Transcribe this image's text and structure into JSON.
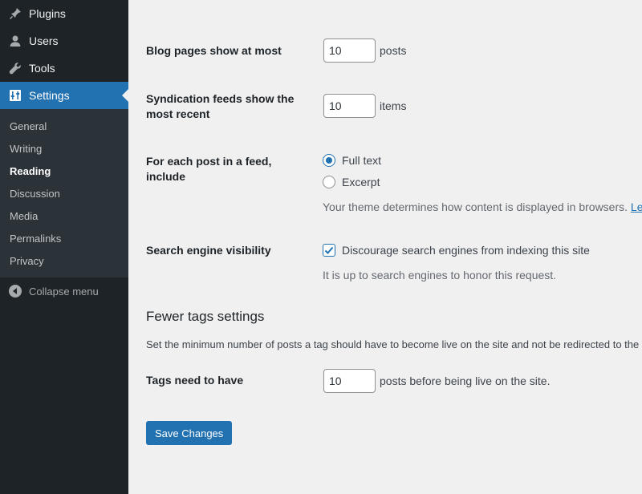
{
  "sidebar": {
    "items": [
      {
        "label": "Plugins",
        "icon": "plugin-icon"
      },
      {
        "label": "Users",
        "icon": "user-icon"
      },
      {
        "label": "Tools",
        "icon": "wrench-icon"
      },
      {
        "label": "Settings",
        "icon": "settings-icon"
      }
    ],
    "submenu": [
      "General",
      "Writing",
      "Reading",
      "Discussion",
      "Media",
      "Permalinks",
      "Privacy"
    ],
    "active_submenu": "Reading",
    "collapse_label": "Collapse menu"
  },
  "form": {
    "blog_pages": {
      "label": "Blog pages show at most",
      "value": "10",
      "suffix": "posts"
    },
    "syndication": {
      "label": "Syndication feeds show the most recent",
      "value": "10",
      "suffix": "items"
    },
    "feed_include": {
      "label": "For each post in a feed, include",
      "options": [
        "Full text",
        "Excerpt"
      ],
      "selected": "Full text",
      "description": "Your theme determines how content is displayed in browsers.",
      "link_text": "Lea"
    },
    "search_visibility": {
      "label": "Search engine visibility",
      "checkbox_label": "Discourage search engines from indexing this site",
      "checked": true,
      "description": "It is up to search engines to honor this request."
    }
  },
  "fewer_tags": {
    "title": "Fewer tags settings",
    "description": "Set the minimum number of posts a tag should have to become live on the site and not be redirected to the",
    "label": "Tags need to have",
    "value": "10",
    "suffix": "posts before being live on the site."
  },
  "save_button": "Save Changes",
  "colors": {
    "accent": "#2271b1",
    "sidebar": "#1d2327",
    "submenu": "#2c3338"
  }
}
